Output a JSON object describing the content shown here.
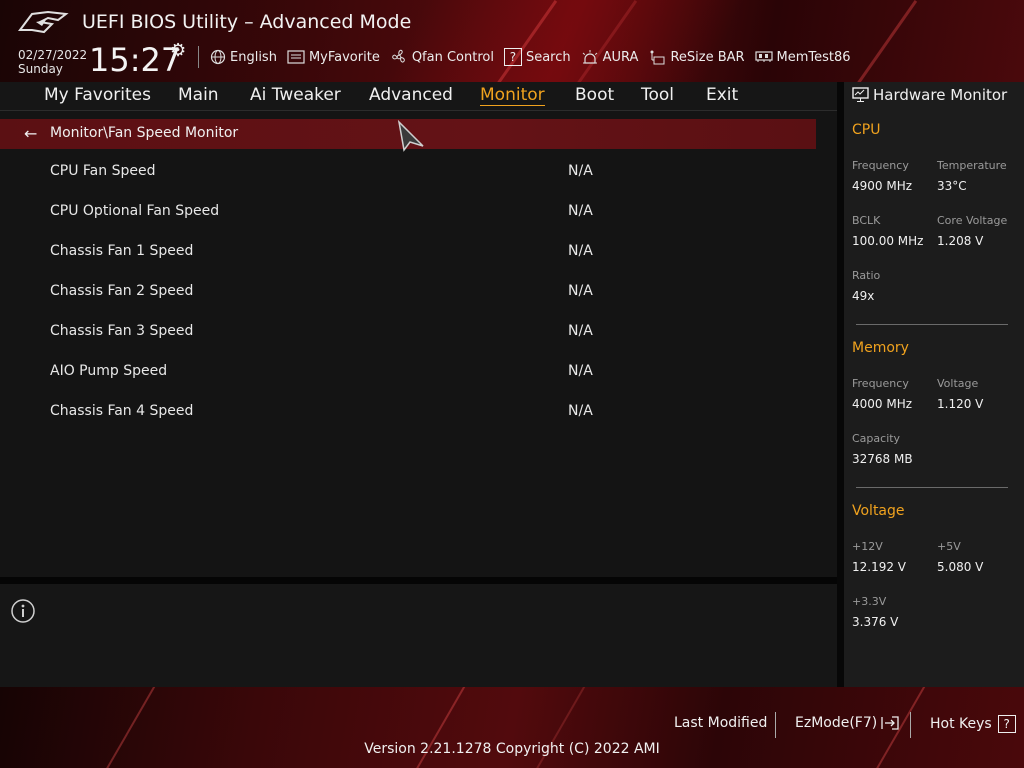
{
  "header": {
    "title": "UEFI BIOS Utility – Advanced Mode",
    "date": "02/27/2022",
    "day": "Sunday",
    "time": "15:27"
  },
  "toolbar": {
    "language": "English",
    "favorite": "MyFavorite",
    "qfan": "Qfan Control",
    "search": "Search",
    "aura": "AURA",
    "resize_bar": "ReSize BAR",
    "memtest": "MemTest86"
  },
  "nav": {
    "tabs": [
      "My Favorites",
      "Main",
      "Ai Tweaker",
      "Advanced",
      "Monitor",
      "Boot",
      "Tool",
      "Exit"
    ],
    "active": "Monitor"
  },
  "breadcrumb": "Monitor\\Fan Speed Monitor",
  "fans": [
    {
      "name": "CPU Fan Speed",
      "value": "N/A"
    },
    {
      "name": "CPU Optional Fan Speed",
      "value": "N/A"
    },
    {
      "name": "Chassis Fan 1 Speed",
      "value": "N/A"
    },
    {
      "name": "Chassis Fan 2 Speed",
      "value": "N/A"
    },
    {
      "name": "Chassis Fan 3 Speed",
      "value": "N/A"
    },
    {
      "name": "AIO Pump Speed",
      "value": "N/A"
    },
    {
      "name": "Chassis Fan 4 Speed",
      "value": "N/A"
    }
  ],
  "hardware_monitor": {
    "title": "Hardware Monitor",
    "cpu": {
      "heading": "CPU",
      "frequency_label": "Frequency",
      "frequency": "4900 MHz",
      "temperature_label": "Temperature",
      "temperature": "33°C",
      "bclk_label": "BCLK",
      "bclk": "100.00 MHz",
      "core_voltage_label": "Core Voltage",
      "core_voltage": "1.208 V",
      "ratio_label": "Ratio",
      "ratio": "49x"
    },
    "memory": {
      "heading": "Memory",
      "frequency_label": "Frequency",
      "frequency": "4000 MHz",
      "voltage_label": "Voltage",
      "voltage": "1.120 V",
      "capacity_label": "Capacity",
      "capacity": "32768 MB"
    },
    "voltage": {
      "heading": "Voltage",
      "v12_label": "+12V",
      "v12": "12.192 V",
      "v5_label": "+5V",
      "v5": "5.080 V",
      "v33_label": "+3.3V",
      "v33": "3.376 V"
    }
  },
  "footer": {
    "last_modified": "Last Modified",
    "ezmode": "EzMode(F7)",
    "hot_keys": "Hot Keys",
    "hot_keys_key": "?",
    "version": "Version 2.21.1278 Copyright (C) 2022 AMI"
  },
  "colors": {
    "accent": "#f0a21e",
    "crumb_bar": "#5b1013",
    "header_red": "#5a0b0e"
  }
}
